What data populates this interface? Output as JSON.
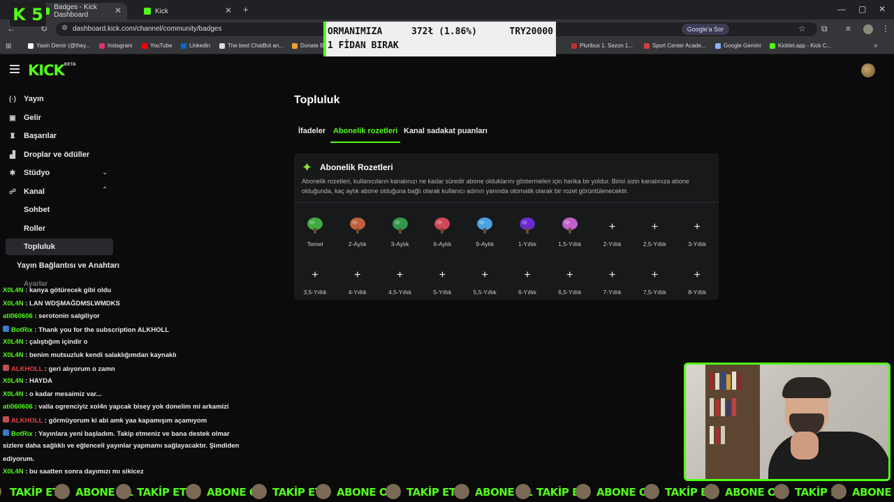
{
  "browser": {
    "tabs": [
      {
        "label": "Badges - Kick Dashboard",
        "active": true
      },
      {
        "label": "Kick",
        "active": false
      }
    ],
    "url": "dashboard.kick.com/channel/community/badges",
    "google_ask": "Google'a Sor",
    "bookmarks": [
      {
        "label": "Yasin Demir (@they...",
        "icon": "x-icon",
        "color": "#ffffff"
      },
      {
        "label": "Instagram",
        "icon": "instagram-icon",
        "color": "#e1306c"
      },
      {
        "label": "YouTube",
        "icon": "youtube-icon",
        "color": "#ff0000"
      },
      {
        "label": "LinkedIn",
        "icon": "linkedin-icon",
        "color": "#0a66c2"
      },
      {
        "label": "The best ChatBot an...",
        "icon": "chatbot-icon",
        "color": "#dddddd"
      },
      {
        "label": "Donate B",
        "icon": "donate-icon",
        "color": "#f0a030"
      },
      {
        "label": "Pluribus 1. Sezon 1...",
        "icon": "pluribus-icon",
        "color": "#c03030"
      },
      {
        "label": "Sport Center Acade...",
        "icon": "sport-icon",
        "color": "#d04040"
      },
      {
        "label": "Google Gemini",
        "icon": "gemini-icon",
        "color": "#8ab4f8"
      },
      {
        "label": "Kicklet.app - Kick C...",
        "icon": "kicklet-icon",
        "color": "#53fc18"
      }
    ]
  },
  "overlay": {
    "logo": "K 5",
    "donation_line1": "ORMANIMIZA",
    "donation_amount": "372ł (1.86%)",
    "donation_goal": "TRY20000",
    "donation_line2": "1 FİDAN BIRAK"
  },
  "dashboard": {
    "logo": "KICK",
    "logo_tag": "BETA",
    "sidebar": {
      "items": [
        {
          "label": "Yayın",
          "icon": "broadcast-icon",
          "glyph": "(·)"
        },
        {
          "label": "Gelir",
          "icon": "revenue-icon",
          "glyph": "▣"
        },
        {
          "label": "Başarılar",
          "icon": "trophy-icon",
          "glyph": "♜"
        },
        {
          "label": "Droplar ve ödüller",
          "icon": "gift-icon",
          "glyph": "▟"
        },
        {
          "label": "Stüdyo",
          "icon": "studio-icon",
          "glyph": "✱"
        },
        {
          "label": "Kanal",
          "icon": "channel-icon",
          "glyph": "☍"
        }
      ],
      "sub_items": [
        "Sohbet",
        "Roller",
        "Topluluk"
      ],
      "extra": "Yayın Bağlantısı ve Anahtarı",
      "settings": "Ayarlar"
    },
    "page_title": "Topluluk",
    "tabs": [
      "İfadeler",
      "Abonelik rozetleri",
      "Kanal sadakat puanları"
    ],
    "active_tab": 1,
    "card": {
      "title": "Abonelik Rozetleri",
      "description": "Abonelik rozetleri, kullanıcıların kanalınızı ne kadar süredir abone olduklarını göstermeleri için harika bir yoldur. Birisi sizin kanalınıza abone olduğunda, kaç aylık abone olduğuna bağlı olarak kullanıcı adının yanında otomatik olarak bir rozet görüntülenecektir.",
      "badges": [
        {
          "label": "Temel",
          "color": "#3faa3f",
          "filled": true
        },
        {
          "label": "2-Aylık",
          "color": "#c0603c",
          "filled": true
        },
        {
          "label": "3-Aylık",
          "color": "#2f9a4a",
          "filled": true
        },
        {
          "label": "6-Aylık",
          "color": "#d04858",
          "filled": true
        },
        {
          "label": "9-Aylık",
          "color": "#4aa0e0",
          "filled": true
        },
        {
          "label": "1-Yıllık",
          "color": "#6a2ad0",
          "filled": true
        },
        {
          "label": "1,5-Yıllık",
          "color": "#c060c8",
          "filled": true
        },
        {
          "label": "2-Yıllık",
          "filled": false
        },
        {
          "label": "2,5-Yıllık",
          "filled": false
        },
        {
          "label": "3-Yıllık",
          "filled": false
        },
        {
          "label": "3,5-Yıllık",
          "filled": false
        },
        {
          "label": "4-Yıllık",
          "filled": false
        },
        {
          "label": "4,5-Yıllık",
          "filled": false
        },
        {
          "label": "5-Yıllık",
          "filled": false
        },
        {
          "label": "5,5-Yıllık",
          "filled": false
        },
        {
          "label": "6-Yıllık",
          "filled": false
        },
        {
          "label": "6,5-Yıllık",
          "filled": false
        },
        {
          "label": "7-Yıllık",
          "filled": false
        },
        {
          "label": "7,5-Yıllık",
          "filled": false
        },
        {
          "label": "8-Yıllık",
          "filled": false
        }
      ]
    }
  },
  "chat": {
    "ghost_text": "Ayarlar",
    "messages": [
      {
        "user": "X0L4N",
        "color": "#53fc18",
        "text": " : kanya götürecek gibi oldu",
        "badge": ""
      },
      {
        "user": "X0L4N",
        "color": "#53fc18",
        "text": " : LAN WDŞMAĞDMSLWMDKS",
        "badge": ""
      },
      {
        "user": "ati060606",
        "color": "#53fc18",
        "text": " : serotonin salgiliyor",
        "badge": ""
      },
      {
        "user": "BotRix",
        "color": "#53fc18",
        "text": " : Thank you for the subscription ALKHOLL",
        "badge": "bot"
      },
      {
        "user": "X0L4N",
        "color": "#53fc18",
        "text": " : çalıştığım içindir o",
        "badge": ""
      },
      {
        "user": "X0L4N",
        "color": "#53fc18",
        "text": " : benim mutsuzluk kendi salaklığımdan kaynaklı",
        "badge": ""
      },
      {
        "user": "ALKHOLL",
        "color": "#e84040",
        "text": " : geri alıyorum o zamn",
        "badge": "sub"
      },
      {
        "user": "X0L4N",
        "color": "#53fc18",
        "text": " : HAYDA",
        "badge": ""
      },
      {
        "user": "X0L4N",
        "color": "#53fc18",
        "text": " : o kadar mesaimiz var...",
        "badge": ""
      },
      {
        "user": "ati060606",
        "color": "#53fc18",
        "text": " : valla ogrenciyiz xol4n yapcak bisey yok donelim mi arkamizi",
        "badge": ""
      },
      {
        "user": "ALKHOLL",
        "color": "#e84040",
        "text": " : görmüyorum ki abi amk yaa kapamışım açamıyom",
        "badge": "sub"
      },
      {
        "user": "BotRix",
        "color": "#53fc18",
        "text": " : Yayınlara yeni başladım. Takip etmeniz ve bana destek olmar",
        "badge": "bot"
      },
      {
        "user": "",
        "color": "#eaeaea",
        "text": "sizlere daha sağlıklı ve eğlenceli yayınlar yapmamı sağlayacaktır. Şimdiden",
        "badge": ""
      },
      {
        "user": "",
        "color": "#eaeaea",
        "text": "ediyorum.",
        "badge": ""
      },
      {
        "user": "X0L4N",
        "color": "#53fc18",
        "text": " : bu saatten sonra dayımızı mı sikicez",
        "badge": ""
      }
    ]
  },
  "ticker": {
    "items": [
      "TAKİP ET",
      "ABONE OL",
      "TAKİP ET",
      "ABONE OL",
      "TAKİP ET",
      "ABONE OL",
      "TAKİP ET",
      "ABONE OL",
      "TAKİP ET",
      "ABONE OL",
      "TAKİP ET",
      "ABONE OL",
      "TAKİP ET",
      "ABONE OL"
    ]
  },
  "colors": {
    "accent": "#53fc18",
    "background": "#0b0b0c",
    "card": "#18191b"
  }
}
